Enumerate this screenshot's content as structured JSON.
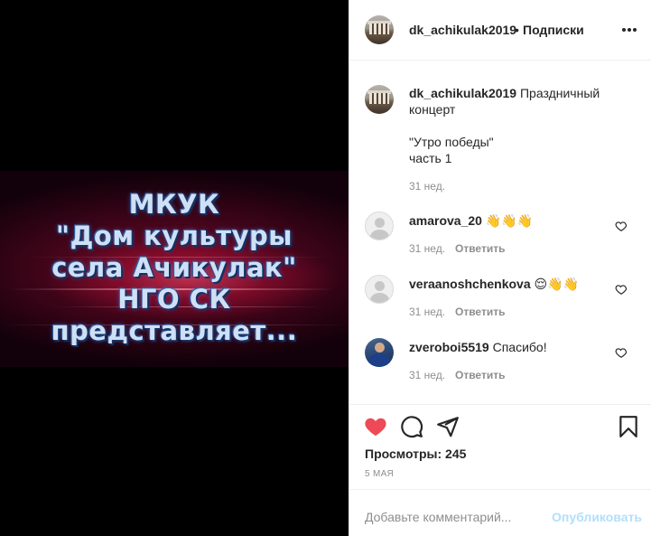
{
  "media": {
    "lines": [
      "МКУК",
      "\"Дом культуры",
      "села Ачикулак\"",
      "НГО СК",
      "представляет..."
    ]
  },
  "header": {
    "username": "dk_achikulak2019",
    "dot": "•",
    "follow_label": "Подписки",
    "more_icon": "more-horizontal-icon"
  },
  "caption": {
    "username": "dk_achikulak2019",
    "lines": [
      "Праздничный",
      "концерт",
      "\"Утро победы\"",
      "часть 1"
    ],
    "time": "31 нед."
  },
  "comments": [
    {
      "username": "amarova_20",
      "text": "👋👋👋",
      "time": "31 нед.",
      "reply": "Ответить"
    },
    {
      "username": "veraanoshchenkova",
      "text": "😌👋👋",
      "time": "31 нед.",
      "reply": "Ответить"
    },
    {
      "username": "zveroboi5519",
      "text": "Спасибо!",
      "time": "31 нед.",
      "reply": "Ответить"
    }
  ],
  "actions": {
    "like_icon": "heart-filled-icon",
    "comment_icon": "comment-icon",
    "share_icon": "share-icon",
    "save_icon": "bookmark-icon",
    "like_color": "#ed4956"
  },
  "stats": {
    "views": "Просмотры: 245",
    "date": "5 МАЯ"
  },
  "comment_box": {
    "placeholder": "Добавьте комментарий...",
    "publish_label": "Опубликовать",
    "publish_color": "#b2dffc"
  }
}
